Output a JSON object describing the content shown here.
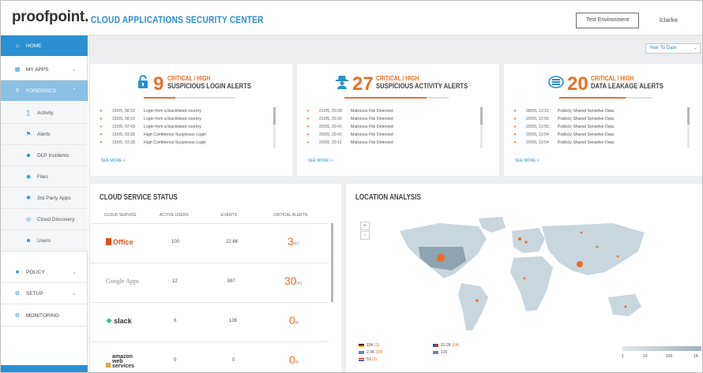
{
  "header": {
    "logo": "proofpoint.",
    "title": "CLOUD APPLICATIONS SECURITY CENTER",
    "env_button": "Test Environment",
    "user": "lclarke"
  },
  "sidebar": {
    "items": [
      {
        "label": "HOME",
        "icon": "home-icon"
      },
      {
        "label": "MY APPS",
        "icon": "apps-icon"
      },
      {
        "label": "FORENSICS",
        "icon": "search-icon"
      },
      {
        "label": "Activity",
        "icon": "activity-icon"
      },
      {
        "label": "Alerts",
        "icon": "flag-icon"
      },
      {
        "label": "DLP Incidents",
        "icon": "dlp-icon"
      },
      {
        "label": "Files",
        "icon": "files-icon"
      },
      {
        "label": "3rd Party Apps",
        "icon": "third-party-icon"
      },
      {
        "label": "Cloud Discovery",
        "icon": "cloud-discovery-icon"
      },
      {
        "label": "Users",
        "icon": "users-icon"
      },
      {
        "label": "POLICY",
        "icon": "policy-icon"
      },
      {
        "label": "SETUP",
        "icon": "gear-icon"
      },
      {
        "label": "MONITORING",
        "icon": "monitor-icon"
      }
    ]
  },
  "period": "Year To Date",
  "alerts": [
    {
      "count": "9",
      "severity": "CRITICAL / HIGH",
      "label": "SUSPICIOUS LOGIN ALERTS",
      "icon": "lock-icon",
      "rows": [
        {
          "time": "15/05, 08:10",
          "text": "Login from a blacklisted country"
        },
        {
          "time": "15/05, 08:10",
          "text": "Login from a blacklisted country"
        },
        {
          "time": "15/05, 07:43",
          "text": "Login from a blacklisted country"
        },
        {
          "time": "15/05, 03:28",
          "text": "High Confidence Suspicious Login"
        },
        {
          "time": "15/05, 03:28",
          "text": "High Confidence Suspicious Login"
        }
      ],
      "see_more": "SEE MORE >"
    },
    {
      "count": "27",
      "severity": "CRITICAL / HIGH",
      "label": "SUSPICIOUS ACTIVITY ALERTS",
      "icon": "spy-icon",
      "rows": [
        {
          "time": "21/05, 20:28",
          "text": "Malicious File Detected"
        },
        {
          "time": "21/05, 20:26",
          "text": "Malicious File Detected"
        },
        {
          "time": "20/05, 20:41",
          "text": "Malicious File Detected"
        },
        {
          "time": "20/05, 20:41",
          "text": "Malicious File Detected"
        },
        {
          "time": "20/05, 20:11",
          "text": "Malicious File Detected"
        }
      ],
      "see_more": "SEE MORE >"
    },
    {
      "count": "20",
      "severity": "CRITICAL / HIGH",
      "label": "DATA LEAKAGE ALERTS",
      "icon": "cloud-data-icon",
      "rows": [
        {
          "time": "08/05, 13:15",
          "text": "Publicly Shared Sensitive Data"
        },
        {
          "time": "20/05, 13:55",
          "text": "Publicly Shared Sensitive Data"
        },
        {
          "time": "20/05, 13:55",
          "text": "Publicly Shared Sensitive Data"
        },
        {
          "time": "20/05, 13:54",
          "text": "Publicly Shared Sensitive Data"
        },
        {
          "time": "20/05, 13:54",
          "text": "Publicly Shared Sensitive Data"
        }
      ],
      "see_more": "SEE MORE >"
    }
  ],
  "cloud_status": {
    "title": "CLOUD SERVICE STATUS",
    "headers": [
      "CLOUD SERVICE",
      "ACTIVE USERS",
      "EVENTS",
      "CRITICAL ALERTS"
    ],
    "rows": [
      {
        "service": "Office",
        "users": "100",
        "events": "22.6K",
        "alerts": "3",
        "alerts_total": "/67"
      },
      {
        "service": "Google Apps",
        "users": "12",
        "events": "867",
        "alerts": "30",
        "alerts_total": "/41"
      },
      {
        "service": "slack",
        "users": "6",
        "events": "136",
        "alerts": "0",
        "alerts_total": "/0"
      },
      {
        "service": "amazon web services",
        "users": "0",
        "events": "0",
        "alerts": "0",
        "alerts_total": "/0"
      }
    ]
  },
  "location": {
    "title": "LOCATION ANALYSIS",
    "zoom_in": "+",
    "zoom_out": "-",
    "legend": [
      {
        "value": "15K",
        "alerts": "(1)"
      },
      {
        "value": "10.2K",
        "alerts": "(64)"
      },
      {
        "value": "2.3K",
        "alerts": "(24)"
      },
      {
        "value": "126",
        "alerts": ""
      },
      {
        "value": "53",
        "alerts": "(3)"
      }
    ],
    "scale": [
      "1",
      "10",
      "100",
      "1K"
    ]
  },
  "colors": {
    "accent": "#2b8fd1",
    "alert": "#e8702a"
  }
}
